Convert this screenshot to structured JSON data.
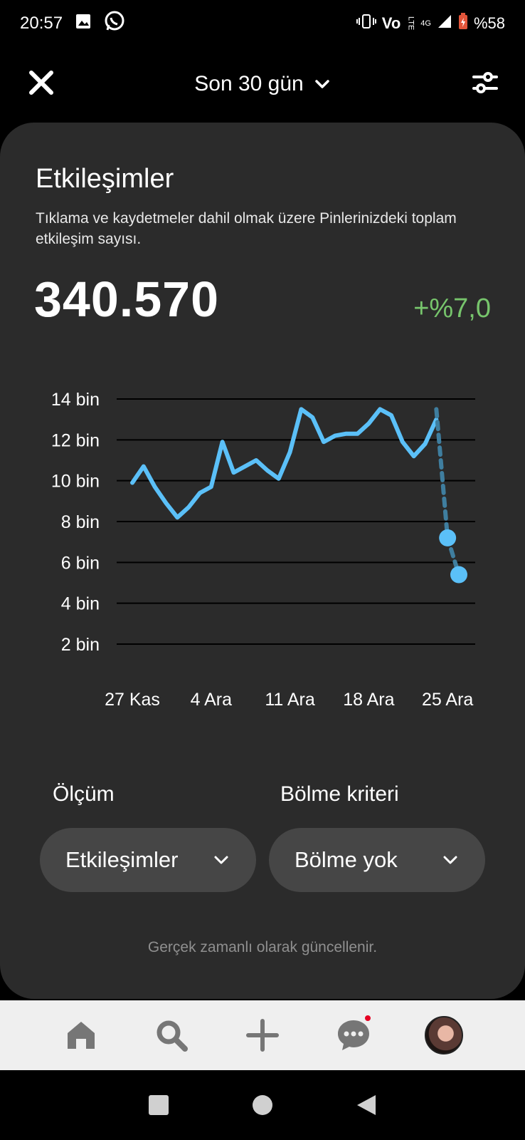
{
  "status_bar": {
    "time": "20:57",
    "battery": "%58",
    "network": "4G",
    "lte": "LTE",
    "volte": "Vo"
  },
  "header": {
    "range_label": "Son 30 gün"
  },
  "card": {
    "title": "Etkileşimler",
    "description": "Tıklama ve kaydetmeler dahil olmak üzere Pinlerinizdeki toplam etkileşim sayısı.",
    "total": "340.570",
    "change": "+%7,0",
    "change_color": "#77c56c",
    "measure_label": "Ölçüm",
    "breakdown_label": "Bölme kriteri",
    "measure_value": "Etkileşimler",
    "breakdown_value": "Bölme yok",
    "footnote": "Gerçek zamanlı olarak güncellenir."
  },
  "chart_data": {
    "type": "line",
    "ytick_labels": [
      "14 bin",
      "12 bin",
      "10 bin",
      "8 bin",
      "6 bin",
      "4 bin",
      "2 bin"
    ],
    "ytick_values": [
      14000,
      12000,
      10000,
      8000,
      6000,
      4000,
      2000
    ],
    "xtick_labels": [
      "27 Kas",
      "4 Ara",
      "11 Ara",
      "18 Ara",
      "25 Ara"
    ],
    "xtick_days": [
      1,
      8,
      15,
      22,
      29
    ],
    "series": [
      {
        "style": "solid",
        "color": "#5bc0f8",
        "x": [
          1,
          2,
          3,
          4,
          5,
          6,
          7,
          8,
          9,
          10,
          11,
          12,
          13,
          14,
          15,
          16,
          17,
          18,
          19,
          20,
          21,
          22,
          23,
          24,
          25,
          26,
          27,
          28
        ],
        "values": [
          9900,
          10700,
          9700,
          8900,
          8200,
          8700,
          9400,
          9700,
          11900,
          10400,
          10700,
          11000,
          10500,
          10100,
          11400,
          13500,
          13100,
          11900,
          12200,
          12300,
          12300,
          12800,
          13500,
          13200,
          11900,
          11200,
          11800,
          13000
        ]
      },
      {
        "style": "dashed",
        "color": "#5bc0f8",
        "x": [
          28,
          29,
          30
        ],
        "values": [
          13500,
          7200,
          5400
        ],
        "markers": [
          29,
          30
        ]
      }
    ],
    "ylim": [
      2000,
      14000
    ],
    "grid": true,
    "dashed_line_color": "#3f7e9f"
  },
  "nav": {
    "items": [
      "home",
      "search",
      "create",
      "messages",
      "profile"
    ]
  }
}
